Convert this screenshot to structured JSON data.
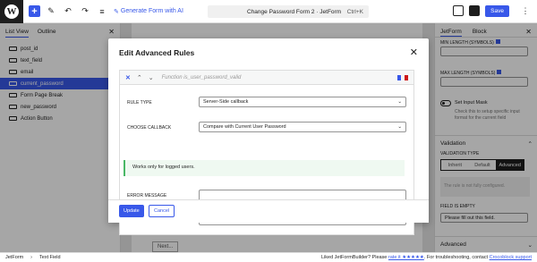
{
  "topbar": {
    "generate_label": "Generate Form with AI",
    "doc_title": "Change Password Form 2 · JetForm",
    "shortcut": "Ctrl+K",
    "save_label": "Save"
  },
  "listview": {
    "tabs": [
      "List View",
      "Outline"
    ],
    "items": [
      {
        "label": "post_id"
      },
      {
        "label": "text_field"
      },
      {
        "label": "email"
      },
      {
        "label": "current_password"
      },
      {
        "label": "Form Page Break"
      },
      {
        "label": "new_password"
      },
      {
        "label": "Action Button"
      }
    ],
    "selected_index": 3
  },
  "canvas": {
    "next_label": "Next..."
  },
  "sidebar": {
    "tabs": [
      "JetForm",
      "Block"
    ],
    "min_length_label": "MIN LENGTH (SYMBOLS)",
    "max_length_label": "MAX LENGTH (SYMBOLS)",
    "set_mask_label": "Set Input Mask",
    "mask_help": "Check this to setup specific input format for the current field",
    "validation_title": "Validation",
    "validation_type_label": "VALIDATION TYPE",
    "validation_options": [
      "Inherit",
      "Default",
      "Advanced"
    ],
    "validation_selected": "Advanced",
    "notice": "The rule is not fully configured.",
    "field_empty_label": "FIELD IS EMPTY",
    "field_empty_value": "Please fill out this field.",
    "advanced_title": "Advanced"
  },
  "modal": {
    "title": "Edit Advanced Rules",
    "rule_placeholder": "Function is_user_password_valid",
    "rule_type_label": "RULE TYPE",
    "rule_type_value": "Server-Side callback",
    "choose_callback_label": "CHOOSE CALLBACK",
    "choose_callback_value": "Compare with Current User Password",
    "notice": "Works only for logged users.",
    "error_message_label": "ERROR MESSAGE",
    "update_label": "Update",
    "cancel_label": "Cancel"
  },
  "statusbar": {
    "crumbs": [
      "JetForm",
      "Text Field"
    ],
    "message": "Liked JetFormBuilder? Please",
    "rate_link": "rate it ★★★★★",
    "message2": ". For troubleshooting, contact",
    "support_link": "Crocoblock support",
    "colors": {
      "accent": "#3858e9",
      "danger": "#cc1818",
      "success": "#4ab866"
    }
  }
}
